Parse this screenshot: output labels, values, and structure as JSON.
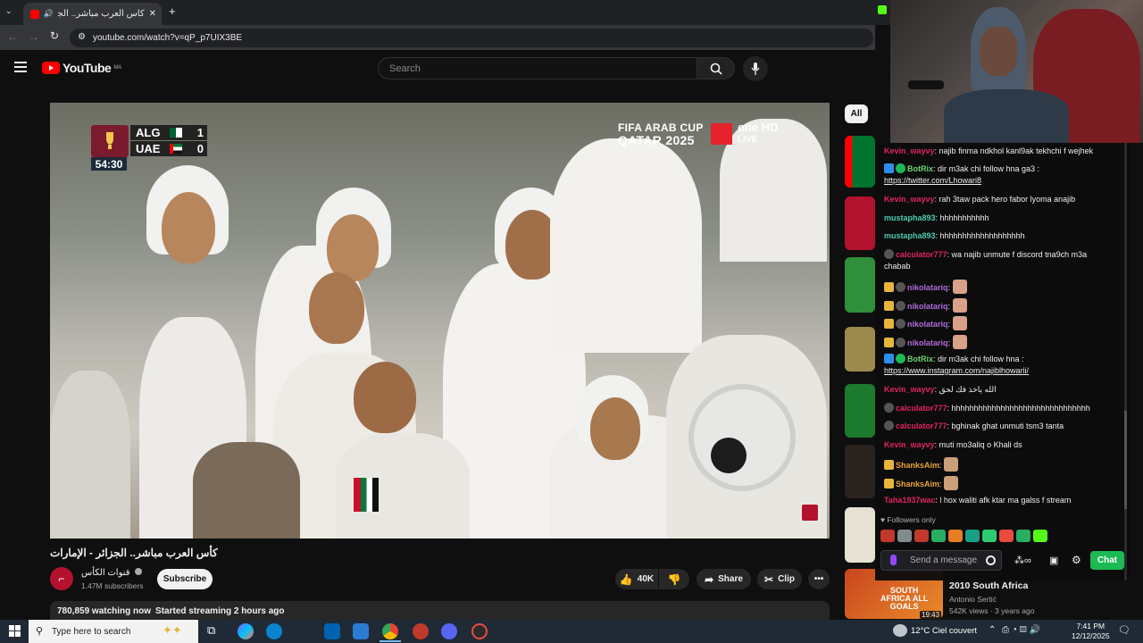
{
  "browser": {
    "tab_title": "كأس العرب مباشر.. الجزائر - الإ",
    "url": "youtube.com/watch?v=qP_p7UIX3BE"
  },
  "youtube": {
    "logo_text": "YouTube",
    "country_code": "MA",
    "search_placeholder": "Search"
  },
  "video_overlay": {
    "team1": "ALG",
    "score1": "1",
    "team2": "UAE",
    "score2": "0",
    "clock": "54:30",
    "event_line1": "FIFA ARAB CUP",
    "event_line2": "QATAR 2025",
    "broadcaster": "one HD",
    "live_label": "LIVE"
  },
  "video": {
    "title": "كأس العرب مباشر.. الجزائر - الإمارات",
    "channel_name": "قنوات الكأس",
    "subscribers": "1.47M subscribers",
    "subscribe_label": "Subscribe",
    "likes": "40K",
    "share_label": "Share",
    "clip_label": "Clip",
    "watching": "780,859 watching now",
    "started": "Started streaming 2 hours ago"
  },
  "filters": {
    "all_label": "All"
  },
  "chat": {
    "messages": [
      {
        "user": "Kevin_wayvy",
        "color": "#e0245e",
        "text": ": najib finma ndkhol kanl9ak tekhchi f wejhek"
      },
      {
        "user": "BotRix",
        "color": "#6dd36d",
        "text": ": dir m3ak chi follow hna ga3 :",
        "link": "https://twitter.com/Lhowari8"
      },
      {
        "user": "Kevin_wayvy",
        "color": "#e0245e",
        "text": ": rah 3taw pack hero fabor lyoma anajib"
      },
      {
        "user": "mustapha893",
        "color": "#4ec9b0",
        "text": ": hhhhhhhhhhh"
      },
      {
        "user": "mustapha893",
        "color": "#4ec9b0",
        "text": ": hhhhhhhhhhhhhhhhhhh"
      },
      {
        "user": "calculator777",
        "color": "#e0245e",
        "text": ": wa najib unmute f discord tna9ch m3a",
        "text2": "chabab"
      },
      {
        "user": "nikolatariq",
        "color": "#b06ad8",
        "text": ":"
      },
      {
        "user": "nikolatariq",
        "color": "#b06ad8",
        "text": ":"
      },
      {
        "user": "nikolatariq",
        "color": "#b06ad8",
        "text": ":"
      },
      {
        "user": "nikolatariq",
        "color": "#b06ad8",
        "text": ":"
      },
      {
        "user": "BotRix",
        "color": "#6dd36d",
        "text": ": dir m3ak chi follow hna :",
        "link": "https://www.instagram.com/najiblhowarii/"
      },
      {
        "user": "Kevin_wayvy",
        "color": "#e0245e",
        "text": ": الله ياخذ فك لحق"
      },
      {
        "user": "calculator777",
        "color": "#e0245e",
        "text": ": hhhhhhhhhhhhhhhhhhhhhhhhhhhhhhh"
      },
      {
        "user": "calculator777",
        "color": "#e0245e",
        "text": ": bghinak ghat unmuti tsm3 tanta"
      },
      {
        "user": "Kevin_wayvy",
        "color": "#e0245e",
        "text": ": muti mo3aliq o Khali ds"
      },
      {
        "user": "ShanksAim",
        "color": "#e8a33c",
        "text": ":"
      },
      {
        "user": "ShanksAim",
        "color": "#e8a33c",
        "text": ":"
      },
      {
        "user": "Taha1937wac",
        "color": "#e0245e",
        "text": ": l hox waliti afk ktar ma galss f stream"
      }
    ],
    "followers_only": "Followers only",
    "input_placeholder": "Send a message",
    "chat_button": "Chat"
  },
  "recommended": {
    "title": "2010 South Africa",
    "channel": "Antonio Sertić",
    "meta": "542K views · 3 years ago",
    "duration": "19:43",
    "thumb_text1": "SOUTH",
    "thumb_text2": "AFRICA ALL",
    "thumb_text3": "GOALS"
  },
  "taskbar": {
    "search_placeholder": "Type here to search",
    "weather": "12°C  Ciel couvert",
    "time": "7:41 PM",
    "date": "12/12/2025"
  },
  "colors": {
    "youtube_red": "#ff0000",
    "chat_green": "#1db954",
    "taskbar": "#1f2a36"
  }
}
